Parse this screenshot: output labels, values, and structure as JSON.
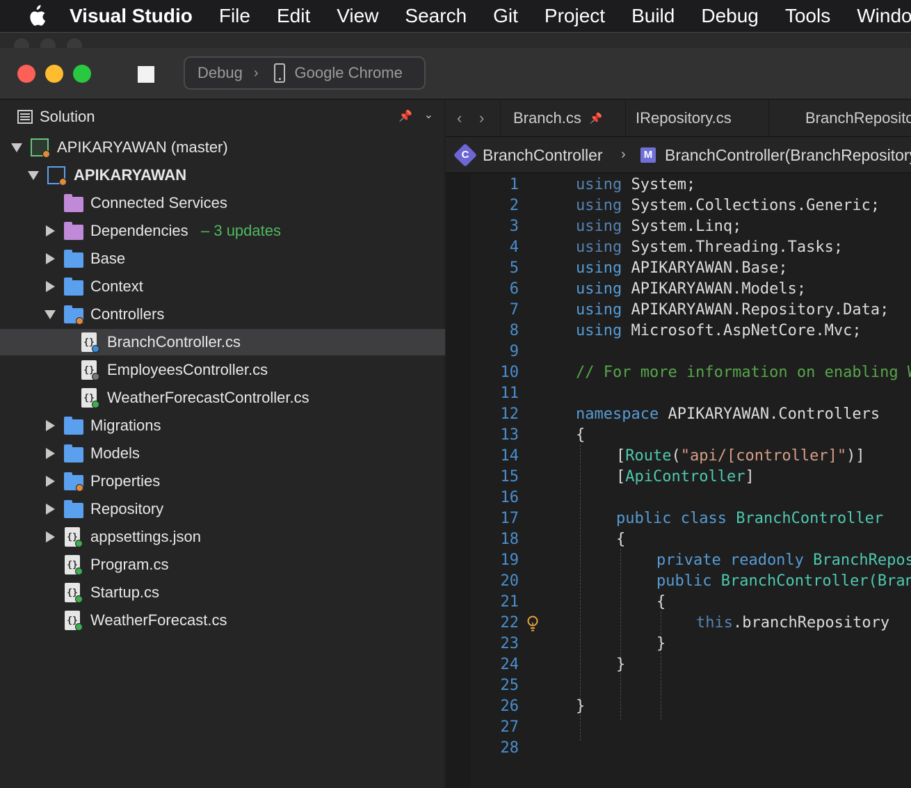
{
  "menubar": {
    "app_name": "Visual Studio",
    "items": [
      "File",
      "Edit",
      "View",
      "Search",
      "Git",
      "Project",
      "Build",
      "Debug",
      "Tools",
      "Window"
    ]
  },
  "toolbar": {
    "configuration": "Debug",
    "target": "Google Chrome"
  },
  "solution_pad": {
    "title": "Solution",
    "tree": [
      {
        "label": "APIKARYAWAN (master)"
      },
      {
        "label": "APIKARYAWAN"
      },
      {
        "label": "Connected Services"
      },
      {
        "label": "Dependencies",
        "badge": "– 3 updates"
      },
      {
        "label": "Base"
      },
      {
        "label": "Context"
      },
      {
        "label": "Controllers"
      },
      {
        "label": "BranchController.cs"
      },
      {
        "label": "EmployeesController.cs"
      },
      {
        "label": "WeatherForecastController.cs"
      },
      {
        "label": "Migrations"
      },
      {
        "label": "Models"
      },
      {
        "label": "Properties"
      },
      {
        "label": "Repository"
      },
      {
        "label": "appsettings.json"
      },
      {
        "label": "Program.cs"
      },
      {
        "label": "Startup.cs"
      },
      {
        "label": "WeatherForecast.cs"
      }
    ]
  },
  "editor": {
    "tabs": [
      "Branch.cs",
      "IRepository.cs",
      "BranchRepository.cs"
    ],
    "breadcrumb": {
      "class_icon": "C",
      "class_name": "BranchController",
      "method_icon": "M",
      "method_name": "BranchController(BranchRepository branchRepository)"
    },
    "line_numbers": [
      "1",
      "2",
      "3",
      "4",
      "5",
      "6",
      "7",
      "8",
      "9",
      "10",
      "11",
      "12",
      "13",
      "14",
      "15",
      "16",
      "17",
      "18",
      "19",
      "20",
      "21",
      "22",
      "23",
      "24",
      "25",
      "26",
      "27",
      "28"
    ],
    "code": {
      "l1_kw": "using",
      "l1_rest": " System;",
      "l2_kw": "using",
      "l2_rest": " System.Collections.Generic;",
      "l3_kw": "using",
      "l3_rest": " System.Linq;",
      "l4_kw": "using",
      "l4_rest": " System.Threading.Tasks;",
      "l5_kw": "using",
      "l5_rest": " APIKARYAWAN.Base;",
      "l6_kw": "using",
      "l6_rest": " APIKARYAWAN.Models;",
      "l7_kw": "using",
      "l7_rest": " APIKARYAWAN.Repository.Data;",
      "l8_kw": "using",
      "l8_rest": " Microsoft.AspNetCore.Mvc;",
      "l10": "// For more information on enabling Web API for empty projects",
      "l12_kw": "namespace",
      "l12_rest": " APIKARYAWAN.Controllers",
      "l13": "{",
      "l14_open": "[",
      "l14_attr": "Route",
      "l14_paren": "(",
      "l14_str": "\"api/[controller]\"",
      "l14_close": ")]",
      "l15_open": "[",
      "l15_attr": "ApiController",
      "l15_close": "]",
      "l17_kw": "public class",
      "l17_type": "BranchController",
      "l18": "{",
      "l19_kw": "private readonly",
      "l19_type": "BranchRepository",
      "l20_kw": "public",
      "l20_type": "BranchController(BranchRepository",
      "l21": "{",
      "l22_kw": "this",
      "l22_rest": ".branchRepository",
      "l23": "}",
      "l24": "}",
      "l26": "}"
    }
  },
  "colors": {
    "accent_blue": "#569cd6",
    "comment_green": "#57a64a",
    "type_teal": "#4ec9b0",
    "string_orange": "#d69d85",
    "update_green": "#4fb95f"
  }
}
